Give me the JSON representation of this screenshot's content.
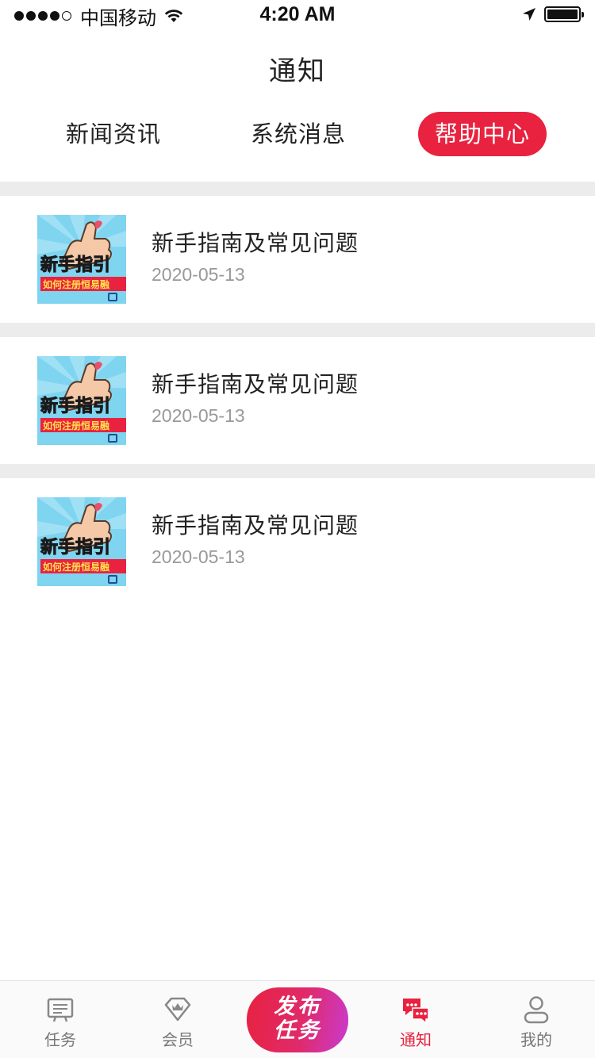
{
  "status_bar": {
    "carrier": "中国移动",
    "time": "4:20 AM"
  },
  "header": {
    "title": "通知"
  },
  "tabs": [
    {
      "label": "新闻资讯",
      "active": false
    },
    {
      "label": "系统消息",
      "active": false
    },
    {
      "label": "帮助中心",
      "active": true
    }
  ],
  "list": [
    {
      "title": "新手指南及常见问题",
      "date": "2020-05-13",
      "thumb_text": "新手指引",
      "thumb_subtext": "如何注册恒易融"
    },
    {
      "title": "新手指南及常见问题",
      "date": "2020-05-13",
      "thumb_text": "新手指引",
      "thumb_subtext": "如何注册恒易融"
    },
    {
      "title": "新手指南及常见问题",
      "date": "2020-05-13",
      "thumb_text": "新手指引",
      "thumb_subtext": "如何注册恒易融"
    }
  ],
  "tabbar": {
    "task": "任务",
    "member": "会员",
    "publish_line1": "发布",
    "publish_line2": "任务",
    "notice": "通知",
    "mine": "我的"
  },
  "colors": {
    "accent": "#e8223f",
    "thumb_bg": "#7fd4f0"
  }
}
